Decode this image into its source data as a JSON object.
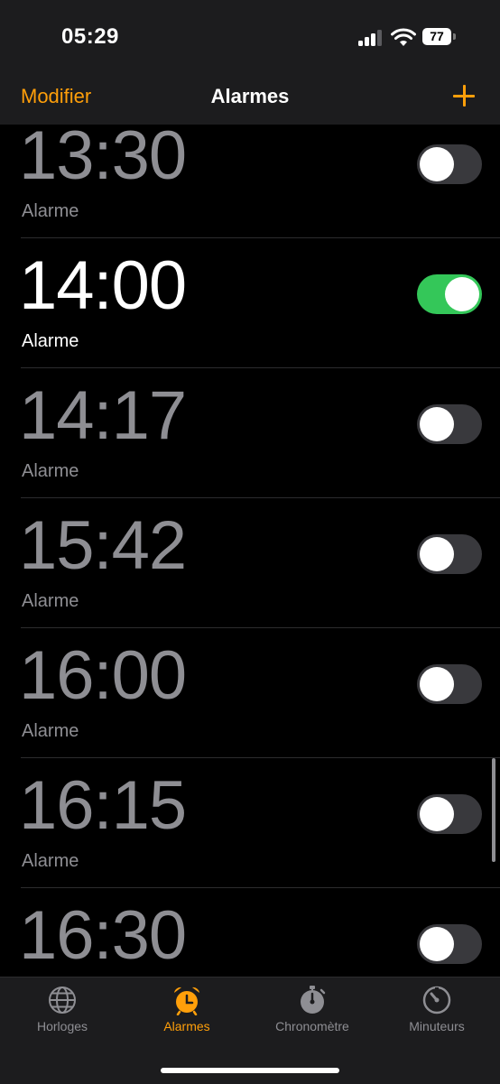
{
  "status_bar": {
    "time": "05:29",
    "battery": "77"
  },
  "nav": {
    "edit_label": "Modifier",
    "title": "Alarmes"
  },
  "alarms": [
    {
      "time": "13:30",
      "label": "Alarme",
      "enabled": false
    },
    {
      "time": "14:00",
      "label": "Alarme",
      "enabled": true
    },
    {
      "time": "14:17",
      "label": "Alarme",
      "enabled": false
    },
    {
      "time": "15:42",
      "label": "Alarme",
      "enabled": false
    },
    {
      "time": "16:00",
      "label": "Alarme",
      "enabled": false
    },
    {
      "time": "16:15",
      "label": "Alarme",
      "enabled": false
    },
    {
      "time": "16:30",
      "label": "",
      "enabled": false
    }
  ],
  "tabs": [
    {
      "label": "Horloges",
      "icon": "globe-icon",
      "active": false
    },
    {
      "label": "Alarmes",
      "icon": "alarm-clock-icon",
      "active": true
    },
    {
      "label": "Chronomètre",
      "icon": "stopwatch-icon",
      "active": false
    },
    {
      "label": "Minuteurs",
      "icon": "timer-icon",
      "active": false
    }
  ],
  "colors": {
    "accent": "#ff9f0a",
    "toggle_on": "#34c759",
    "toggle_off": "#39393d",
    "inactive_text": "#8e8e93"
  }
}
